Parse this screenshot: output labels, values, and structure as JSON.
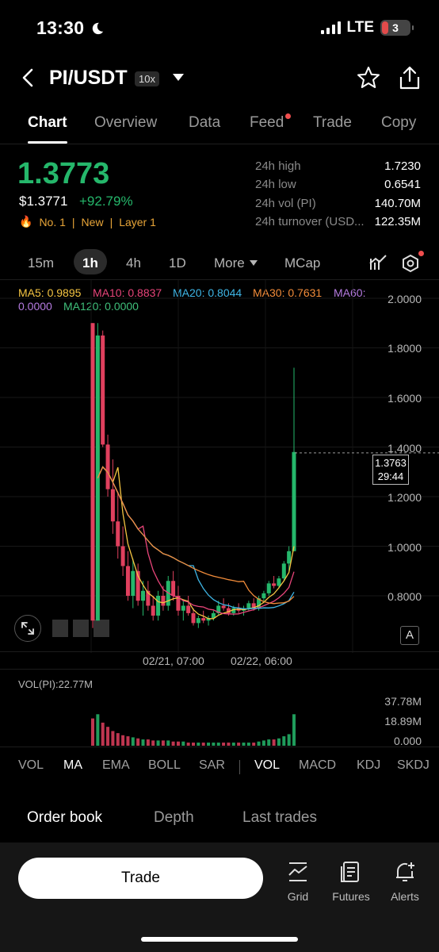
{
  "status": {
    "time": "13:30",
    "network": "LTE",
    "battery": "3"
  },
  "header": {
    "pair": "PI/USDT",
    "leverage": "10x"
  },
  "tabs": [
    {
      "label": "Chart",
      "active": true
    },
    {
      "label": "Overview"
    },
    {
      "label": "Data"
    },
    {
      "label": "Feed",
      "badge": true
    },
    {
      "label": "Trade"
    },
    {
      "label": "Copy"
    }
  ],
  "price": {
    "last": "1.3773",
    "usd": "$1.3771",
    "change": "+92.79%"
  },
  "tags": {
    "rank": "No. 1",
    "new": "New",
    "layer": "Layer 1"
  },
  "stats": [
    {
      "label": "24h high",
      "value": "1.7230"
    },
    {
      "label": "24h low",
      "value": "0.6541"
    },
    {
      "label": "24h vol (PI)",
      "value": "140.70M"
    },
    {
      "label": "24h turnover (USD...",
      "value": "122.35M"
    }
  ],
  "timeframes": {
    "t15m": "15m",
    "t1h": "1h",
    "t4h": "4h",
    "t1d": "1D",
    "more": "More",
    "mcap": "MCap"
  },
  "ma": {
    "ma5": "MA5: 0.9895",
    "ma10": "MA10: 0.8837",
    "ma20": "MA20: 0.8044",
    "ma30": "MA30: 0.7631",
    "ma60": "MA60:",
    "ma60v": "0.0000",
    "ma120": "MA120: 0.0000"
  },
  "colors": {
    "up": "#25b76b",
    "down": "#e0405e",
    "ma5": "#f5c542",
    "ma10": "#e8457a",
    "ma20": "#3fb6e6",
    "ma30": "#f28c3a",
    "ma60": "#b57be0",
    "ma120": "#3fbf7a"
  },
  "chart": {
    "yticks": [
      "2.0000",
      "1.8000",
      "1.6000",
      "1.4000",
      "1.2000",
      "1.0000",
      "0.8000"
    ],
    "current_price": "1.3763",
    "countdown": "29:44",
    "xticks": [
      "02/21, 07:00",
      "02/22, 06:00"
    ],
    "watermark": "OKX"
  },
  "chart_data": {
    "type": "candlestick",
    "ylim": [
      0.6,
      2.0
    ],
    "current_price": 1.3763,
    "candles": [
      [
        1.9,
        1.9,
        0.67,
        0.7
      ],
      [
        0.7,
        1.9,
        0.7,
        1.85
      ],
      [
        1.85,
        1.87,
        1.4,
        1.41
      ],
      [
        1.41,
        1.45,
        1.2,
        1.23
      ],
      [
        1.23,
        1.35,
        1.05,
        1.1
      ],
      [
        1.1,
        1.22,
        0.95,
        1.0
      ],
      [
        1.0,
        1.08,
        0.88,
        0.92
      ],
      [
        0.92,
        0.98,
        0.78,
        0.8
      ],
      [
        0.8,
        0.95,
        0.75,
        0.9
      ],
      [
        0.9,
        0.93,
        0.76,
        0.78
      ],
      [
        0.78,
        0.86,
        0.72,
        0.82
      ],
      [
        0.82,
        0.86,
        0.74,
        0.76
      ],
      [
        0.76,
        0.8,
        0.7,
        0.72
      ],
      [
        0.72,
        0.82,
        0.7,
        0.8
      ],
      [
        0.8,
        0.84,
        0.74,
        0.76
      ],
      [
        0.76,
        0.88,
        0.74,
        0.86
      ],
      [
        0.86,
        0.9,
        0.78,
        0.8
      ],
      [
        0.8,
        0.84,
        0.72,
        0.74
      ],
      [
        0.74,
        0.78,
        0.7,
        0.76
      ],
      [
        0.76,
        0.8,
        0.72,
        0.73
      ],
      [
        0.73,
        0.75,
        0.68,
        0.69
      ],
      [
        0.69,
        0.72,
        0.67,
        0.71
      ],
      [
        0.71,
        0.74,
        0.69,
        0.7
      ],
      [
        0.7,
        0.72,
        0.68,
        0.71
      ],
      [
        0.71,
        0.74,
        0.7,
        0.73
      ],
      [
        0.73,
        0.78,
        0.72,
        0.76
      ],
      [
        0.76,
        0.79,
        0.74,
        0.75
      ],
      [
        0.75,
        0.77,
        0.72,
        0.73
      ],
      [
        0.73,
        0.76,
        0.72,
        0.75
      ],
      [
        0.75,
        0.77,
        0.73,
        0.74
      ],
      [
        0.74,
        0.76,
        0.72,
        0.75
      ],
      [
        0.75,
        0.78,
        0.74,
        0.77
      ],
      [
        0.77,
        0.79,
        0.74,
        0.75
      ],
      [
        0.75,
        0.8,
        0.74,
        0.79
      ],
      [
        0.79,
        0.82,
        0.77,
        0.81
      ],
      [
        0.81,
        0.86,
        0.8,
        0.85
      ],
      [
        0.85,
        0.88,
        0.83,
        0.84
      ],
      [
        0.84,
        0.88,
        0.83,
        0.87
      ],
      [
        0.87,
        0.94,
        0.86,
        0.93
      ],
      [
        0.93,
        1.0,
        0.9,
        0.98
      ],
      [
        0.98,
        1.72,
        0.98,
        1.38
      ]
    ]
  },
  "volume": {
    "label": "VOL(PI):22.77M",
    "yticks": [
      "37.78M",
      "18.89M",
      "0.000"
    ],
    "values": [
      26,
      30,
      22,
      18,
      14,
      12,
      10,
      9,
      8,
      7,
      6,
      6,
      5,
      5,
      5,
      5,
      4,
      4,
      4,
      3,
      3,
      3,
      3,
      3,
      3,
      3,
      3,
      3,
      3,
      3,
      3,
      3,
      3,
      4,
      5,
      6,
      6,
      7,
      9,
      11,
      30
    ]
  },
  "indicators": [
    "VOL",
    "MA",
    "EMA",
    "BOLL",
    "SAR",
    "VOL",
    "MACD",
    "KDJ",
    "SKDJ"
  ],
  "orderbook_tabs": [
    "Order book",
    "Depth",
    "Last trades"
  ],
  "bottom": {
    "trade": "Trade",
    "grid": "Grid",
    "futures": "Futures",
    "alerts": "Alerts"
  }
}
